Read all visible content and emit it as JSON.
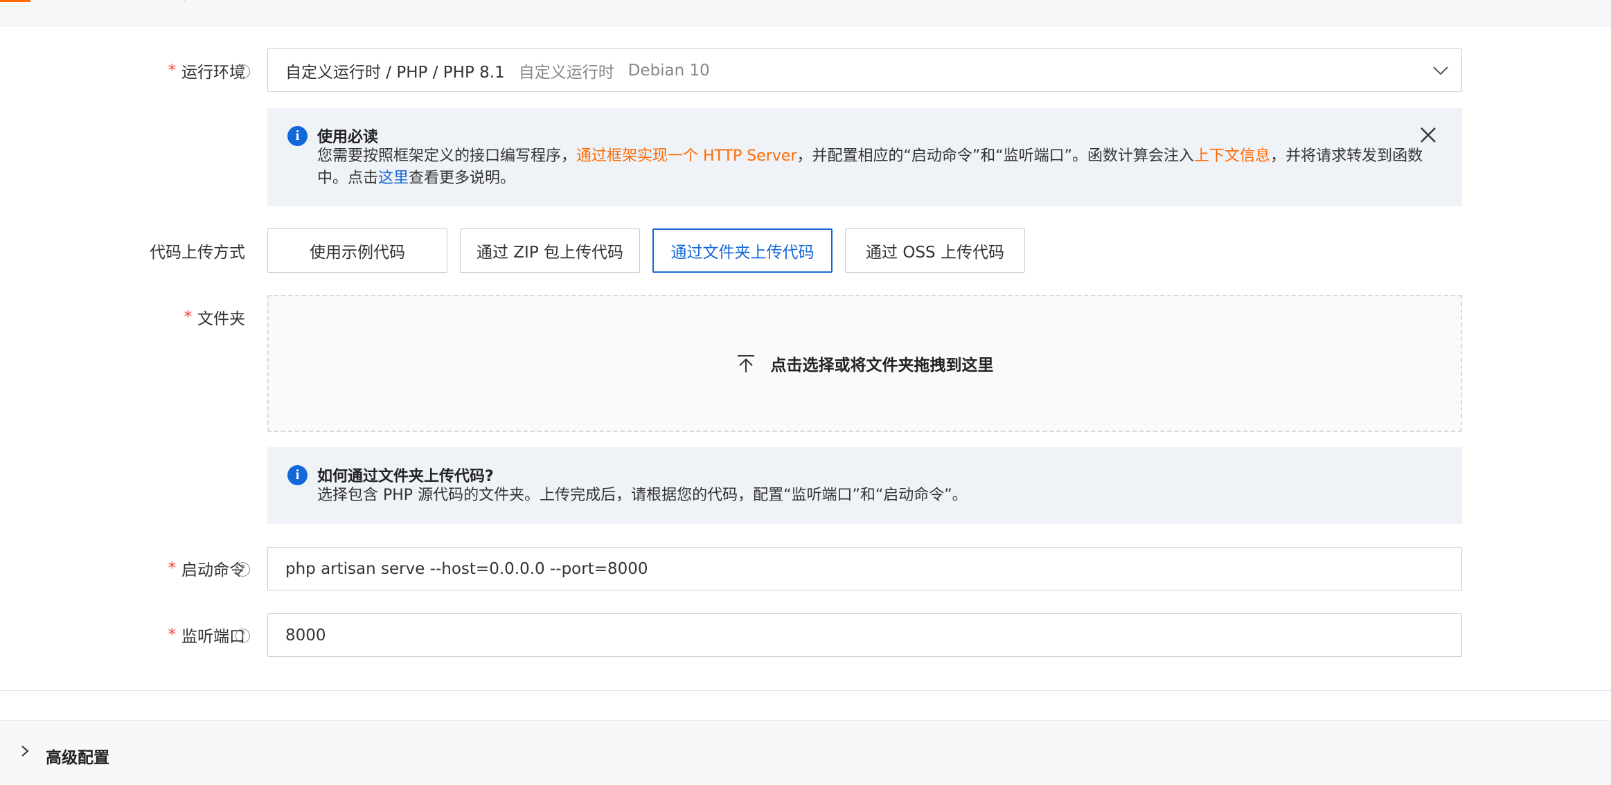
{
  "runtime": {
    "label": "运行环境",
    "value_main": "自定义运行时 / PHP /  PHP 8.1",
    "value_type": "自定义运行时",
    "value_os": "Debian 10"
  },
  "notice_usage": {
    "title": "使用必读",
    "text1": "您需要按照框架定义的接口编写程序，",
    "link1": "通过框架实现一个 HTTP Server",
    "text2": "，并配置相应的“启动命令”和“监听端口”。函数计算会注入",
    "link2": "上下文信息",
    "text3": "，并将请求转发到函数中。点击",
    "link3": "这里",
    "text4": "查看更多说明。"
  },
  "upload": {
    "label": "代码上传方式",
    "options": [
      "使用示例代码",
      "通过 ZIP 包上传代码",
      "通过文件夹上传代码",
      "通过 OSS 上传代码"
    ],
    "selected": "通过文件夹上传代码"
  },
  "folder": {
    "label": "文件夹",
    "dropzone_text": "点击选择或将文件夹拖拽到这里"
  },
  "notice_folder": {
    "title": "如何通过文件夹上传代码?",
    "text": "选择包含 PHP 源代码的文件夹。上传完成后，请根据您的代码，配置“监听端口”和“启动命令”。"
  },
  "start_command": {
    "label": "启动命令",
    "value": "php artisan serve --host=0.0.0.0 --port=8000"
  },
  "listen_port": {
    "label": "监听端口",
    "value": "8000"
  },
  "advanced": {
    "label": "高级配置"
  },
  "colors": {
    "accent": "#ff6a00",
    "primary": "#1368d9",
    "required": "#ff3d3d"
  }
}
